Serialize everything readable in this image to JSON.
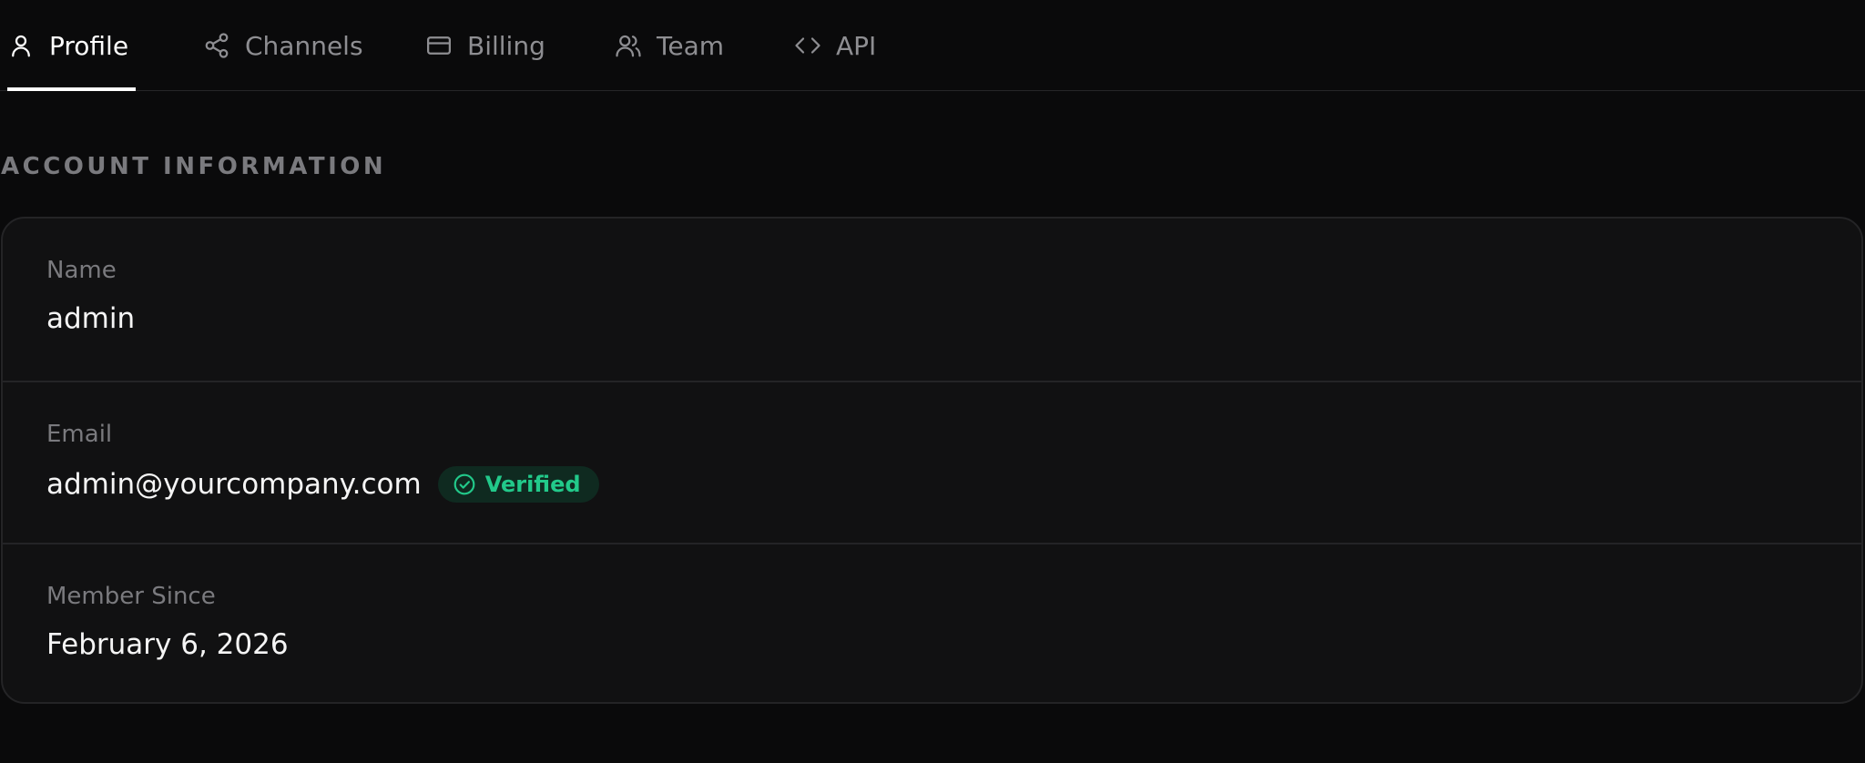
{
  "tabs": [
    {
      "label": "Profile",
      "icon": "user-icon",
      "active": true
    },
    {
      "label": "Channels",
      "icon": "share-icon",
      "active": false
    },
    {
      "label": "Billing",
      "icon": "credit-card-icon",
      "active": false
    },
    {
      "label": "Team",
      "icon": "users-icon",
      "active": false
    },
    {
      "label": "API",
      "icon": "code-icon",
      "active": false
    }
  ],
  "section": {
    "title": "ACCOUNT INFORMATION"
  },
  "account": {
    "name_label": "Name",
    "name_value": "admin",
    "email_label": "Email",
    "email_value": "admin@yourcompany.com",
    "email_status": "Verified",
    "member_since_label": "Member Since",
    "member_since_value": "February 6, 2026"
  },
  "colors": {
    "background": "#0a0a0b",
    "card": "#111112",
    "verified": "#22c98a",
    "muted": "#8e8e92"
  }
}
